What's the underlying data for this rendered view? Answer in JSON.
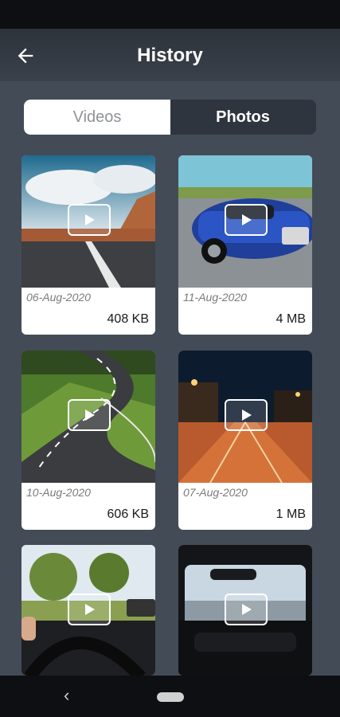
{
  "app_bar": {
    "title": "History",
    "back_icon": "arrow-left-icon"
  },
  "tabs": [
    {
      "label": "Videos",
      "selected": false
    },
    {
      "label": "Photos",
      "selected": true
    }
  ],
  "items": [
    {
      "date": "06-Aug-2020",
      "size": "408 KB"
    },
    {
      "date": "11-Aug-2020",
      "size": "4 MB"
    },
    {
      "date": "10-Aug-2020",
      "size": "606 KB"
    },
    {
      "date": "07-Aug-2020",
      "size": "1 MB"
    },
    {
      "date": "",
      "size": ""
    },
    {
      "date": "",
      "size": ""
    }
  ],
  "colors": {
    "background": "#434b56",
    "app_bar": "#3a414b",
    "card": "#ffffff"
  }
}
